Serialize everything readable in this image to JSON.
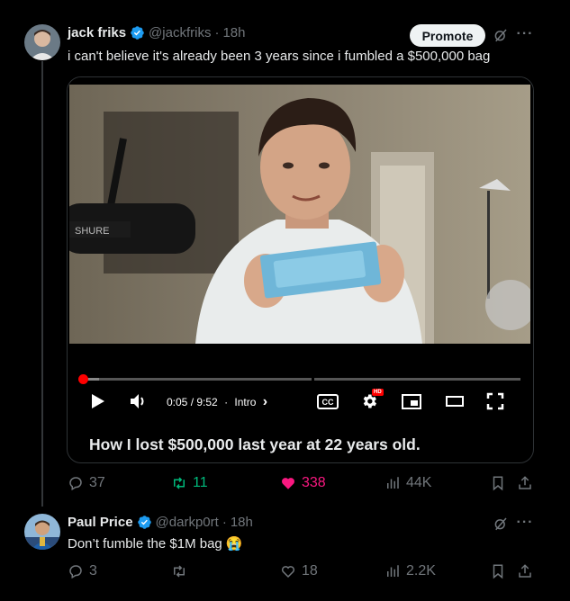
{
  "tweet1": {
    "name": "jack friks",
    "handle": "@jackfriks",
    "separator": "·",
    "time": "18h",
    "text": "i can't believe it's already been 3 years since i fumbled a $500,000 bag",
    "promote_label": "Promote",
    "more_label": "···",
    "video": {
      "current_time": "0:05 / 9:52",
      "chapter_separator": "·",
      "chapter": "Intro",
      "chapter_chevron": "›",
      "cc_label": "CC",
      "hd_badge": "HD",
      "title": "How I lost $500,000 last year at 22 years old.",
      "progress_played": 0.009,
      "progress_buffered": 0.045,
      "mic_brand": "SHURE"
    },
    "stats": {
      "replies": "37",
      "retweets": "11",
      "likes": "338",
      "views": "44K"
    }
  },
  "tweet2": {
    "name": "Paul Price",
    "handle": "@darkp0rt",
    "separator": "·",
    "time": "18h",
    "text": "Don’t fumble the $1M bag 😭",
    "more_label": "···",
    "stats": {
      "replies": "3",
      "retweets": "",
      "likes": "18",
      "views": "2.2K"
    }
  },
  "colors": {
    "background": "#000000",
    "text": "#e7e9ea",
    "muted": "#71767b",
    "verified": "#1d9bf0",
    "retweet": "#00ba7c",
    "like": "#f91880",
    "progress": "#ff0000"
  }
}
